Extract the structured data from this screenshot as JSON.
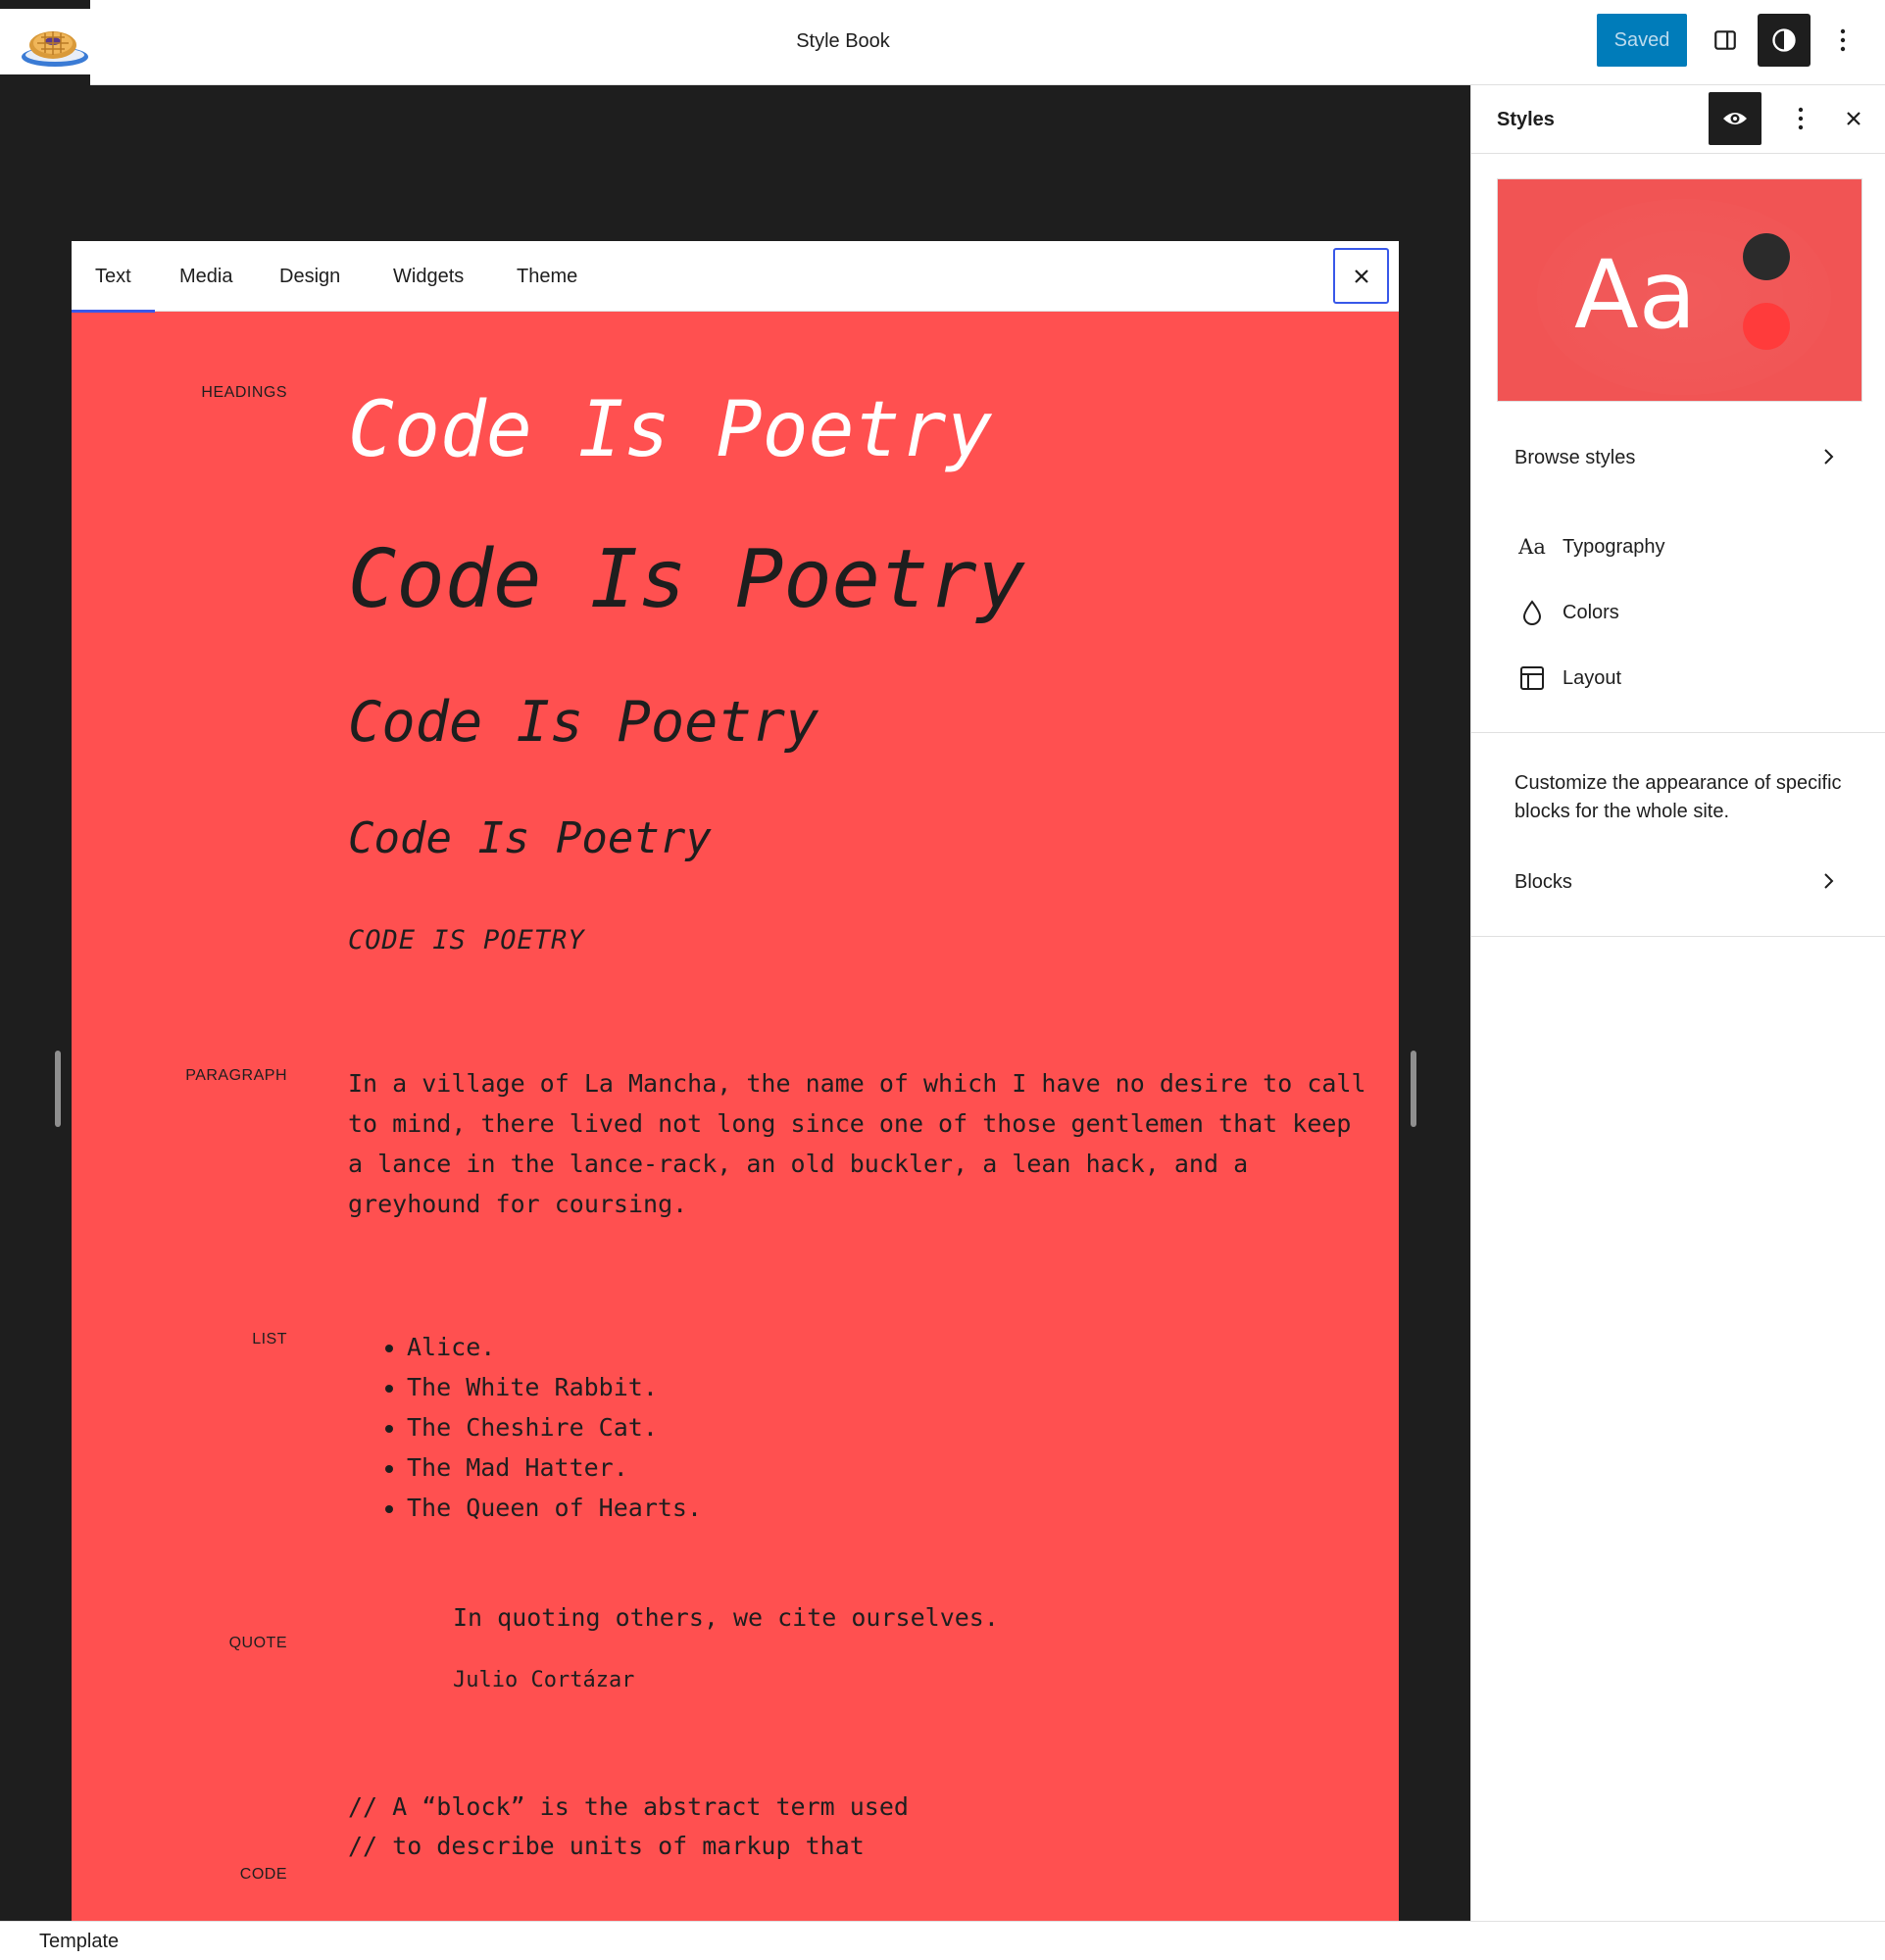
{
  "topbar": {
    "document_title": "Style Book",
    "saved_label": "Saved"
  },
  "stylebook": {
    "tabs": [
      {
        "label": "Text"
      },
      {
        "label": "Media"
      },
      {
        "label": "Design"
      },
      {
        "label": "Widgets"
      },
      {
        "label": "Theme"
      }
    ],
    "sections": {
      "headings_label": "HEADINGS",
      "paragraph_label": "PARAGRAPH",
      "list_label": "LIST",
      "quote_label": "QUOTE",
      "code_label": "CODE"
    },
    "headings": {
      "h1": "Code Is Poetry",
      "h2": "Code Is Poetry",
      "h3": "Code Is Poetry",
      "h4": "Code Is Poetry",
      "h5": "CODE IS POETRY"
    },
    "paragraph": "In a village of La Mancha, the name of which I have no desire to call to mind, there lived not long since one of those gentlemen that keep a lance in the lance-rack, an old buckler, a lean hack, and a greyhound for coursing.",
    "list": [
      "Alice.",
      "The White Rabbit.",
      "The Cheshire Cat.",
      "The Mad Hatter.",
      "The Queen of Hearts."
    ],
    "quote": {
      "text": "In quoting others, we cite ourselves.",
      "citation": "Julio Cortázar"
    },
    "code": {
      "line1": "// A “block” is the abstract term used",
      "line2": "// to describe units of markup that"
    }
  },
  "sidebar": {
    "title": "Styles",
    "preview_text": "Aa",
    "browse_styles": "Browse styles",
    "typography": "Typography",
    "typography_icon_text": "Aa",
    "colors": "Colors",
    "layout": "Layout",
    "description": "Customize the appearance of specific blocks for the whole site.",
    "blocks": "Blocks"
  },
  "footer": {
    "breadcrumb": "Template"
  },
  "colors": {
    "accent": "#3858e9",
    "saved_button": "#007cba",
    "stylebook_bg": "#ff5050",
    "dark": "#1e1e1e"
  }
}
